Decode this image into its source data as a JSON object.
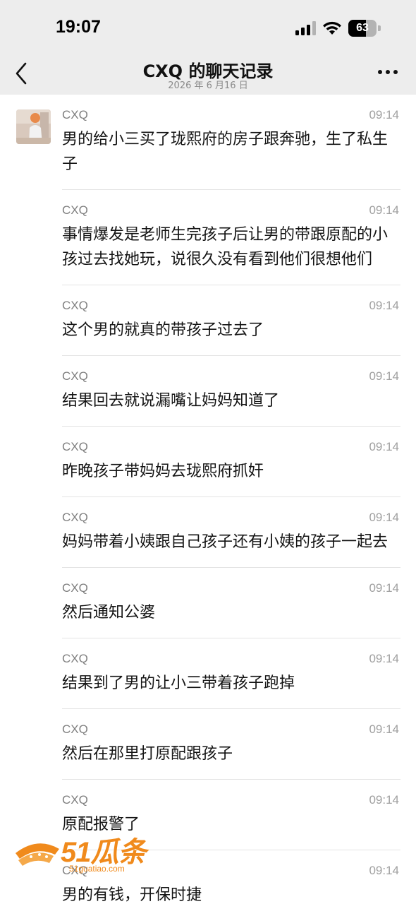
{
  "status_bar": {
    "time": "19:07",
    "battery_level": "63",
    "icons": [
      "cellular-signal-icon",
      "wifi-icon",
      "battery-icon"
    ]
  },
  "nav": {
    "title": "CXQ 的聊天记录",
    "subtitle": "2026 年 6 月16 日",
    "back_icon": "chevron-left-icon",
    "more_icon": "more-dots-icon"
  },
  "messages": [
    {
      "sender": "CXQ",
      "time": "09:14",
      "text": "男的给小三买了珑熙府的房子跟奔驰，生了私生子"
    },
    {
      "sender": "CXQ",
      "time": "09:14",
      "text": "事情爆发是老师生完孩子后让男的带跟原配的小孩过去找她玩，说很久没有看到他们很想他们"
    },
    {
      "sender": "CXQ",
      "time": "09:14",
      "text": "这个男的就真的带孩子过去了"
    },
    {
      "sender": "CXQ",
      "time": "09:14",
      "text": "结果回去就说漏嘴让妈妈知道了"
    },
    {
      "sender": "CXQ",
      "time": "09:14",
      "text": "昨晚孩子带妈妈去珑熙府抓奸"
    },
    {
      "sender": "CXQ",
      "time": "09:14",
      "text": "妈妈带着小姨跟自己孩子还有小姨的孩子一起去"
    },
    {
      "sender": "CXQ",
      "time": "09:14",
      "text": "然后通知公婆"
    },
    {
      "sender": "CXQ",
      "time": "09:14",
      "text": "结果到了男的让小三带着孩子跑掉"
    },
    {
      "sender": "CXQ",
      "time": "09:14",
      "text": "然后在那里打原配跟孩子"
    },
    {
      "sender": "CXQ",
      "time": "09:14",
      "text": "原配报警了"
    },
    {
      "sender": "CXQ",
      "time": "09:14",
      "text": "男的有钱，开保时捷"
    }
  ],
  "watermark": {
    "brand": "51瓜条",
    "domain": "51guatiao.com",
    "color": "#f08a1c"
  },
  "colors": {
    "header_bg": "#ededed",
    "divider": "#e3e3e3",
    "meta_text": "#7f7f7f"
  }
}
